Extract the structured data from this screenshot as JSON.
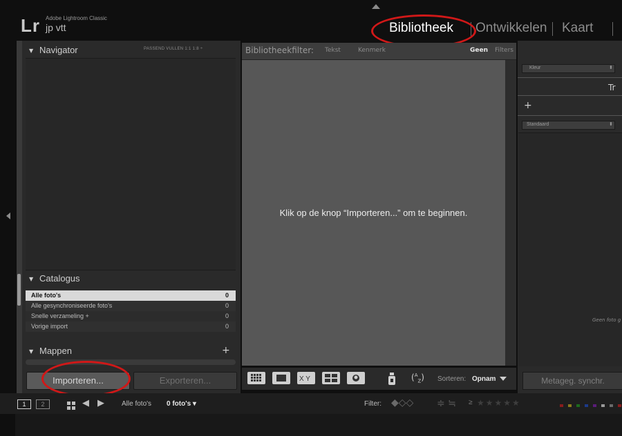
{
  "identity": {
    "logo": "Lr",
    "app_name": "Adobe Lightroom Classic",
    "catalog": "jp vtt"
  },
  "modules": {
    "library": "Bibliotheek",
    "develop": "Ontwikkelen",
    "map": "Kaart"
  },
  "navigator": {
    "title": "Navigator",
    "options": "PASSEND   VULLEN   1:1   1:8 ÷"
  },
  "catalog_panel": {
    "title": "Catalogus",
    "rows": [
      {
        "label": "Alle foto's",
        "count": "0"
      },
      {
        "label": "Alle gesynchroniseerde foto's",
        "count": "0"
      },
      {
        "label": "Snelle verzameling +",
        "count": "0"
      },
      {
        "label": "Vorige import",
        "count": "0"
      }
    ]
  },
  "folders_panel": {
    "title": "Mappen",
    "add": "+"
  },
  "left_buttons": {
    "import": "Importeren...",
    "export": "Exporteren..."
  },
  "filter_bar": {
    "label": "Bibliotheekfilter:",
    "text": "Tekst",
    "attribute": "Kenmerk",
    "none": "Geen",
    "filters": "Filters"
  },
  "center": {
    "empty_message": "Klik op de knop “Importeren...” om te beginnen."
  },
  "toolbar": {
    "sort_label": "Sorteren:",
    "sort_value": "Opnam"
  },
  "right_panel": {
    "color_select": "Kleur",
    "header_partial": "Tr",
    "add": "+",
    "preset_select": "Standaard",
    "no_photo": "Geen foto g",
    "sync_button": "Metageg. synchr."
  },
  "filmstrip_bar": {
    "screen1": "1",
    "screen2": "2",
    "source": "Alle foto's",
    "count": "0 foto's ▾",
    "filter_label": "Filter:",
    "rating_op": "≥"
  },
  "colors": {
    "highlight_ring": "#d01818",
    "selected_row": "#d9d9d9",
    "center_bg": "#575757"
  }
}
